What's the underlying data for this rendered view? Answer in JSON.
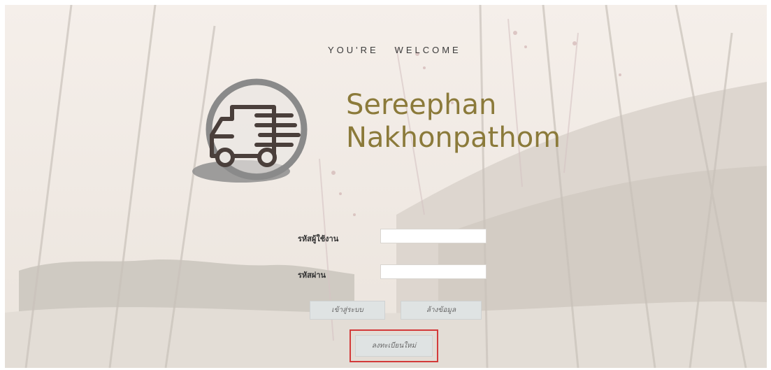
{
  "header": {
    "welcome_text": "YOU'RE   WELCOME"
  },
  "brand": {
    "line1": "Sereephan",
    "line2": "Nakhonpathom",
    "color": "#8b7a3a",
    "logo_icon": "delivery-truck-icon"
  },
  "login_form": {
    "username_label": "รหัสผู้ใช้งาน",
    "username_value": "",
    "password_label": "รหัสผ่าน",
    "password_value": "",
    "login_button_label": "เข้าสู่ระบบ",
    "clear_button_label": "ล้างข้อมูล",
    "register_button_label": "ลงทะเบียนใหม่"
  },
  "colors": {
    "highlight_border": "#d33a3a",
    "button_bg": "#dfe3e3"
  }
}
